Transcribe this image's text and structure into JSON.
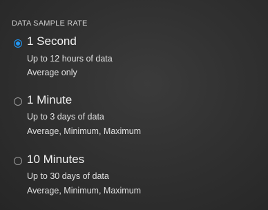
{
  "header": {
    "title": "DATA SAMPLE RATE"
  },
  "options": [
    {
      "title": "1 Second",
      "line1": "Up to 12 hours of data",
      "line2": "Average only",
      "selected": true
    },
    {
      "title": "1 Minute",
      "line1": "Up to 3 days of data",
      "line2": "Average, Minimum, Maximum",
      "selected": false
    },
    {
      "title": "10 Minutes",
      "line1": "Up to 30 days of data",
      "line2": "Average, Minimum, Maximum",
      "selected": false
    }
  ],
  "colors": {
    "accent": "#2196f3",
    "background": "#2e2e2e"
  }
}
